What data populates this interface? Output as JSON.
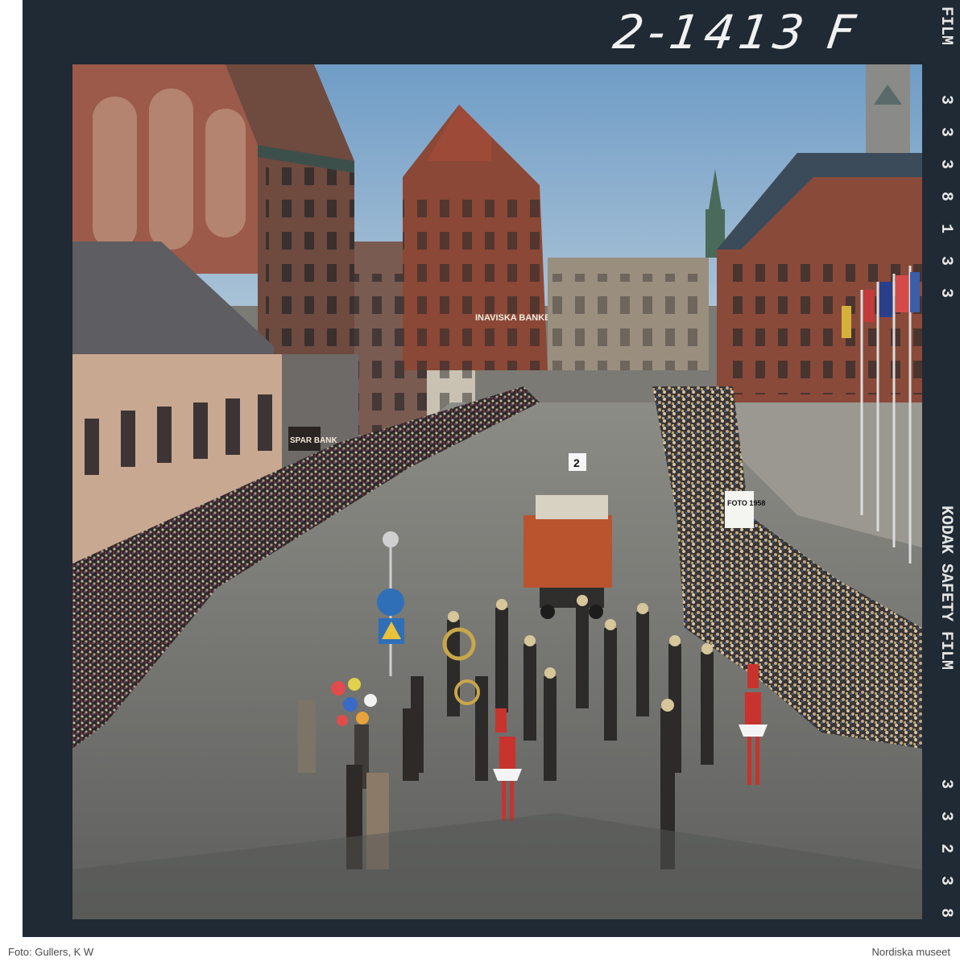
{
  "negative_number": "2-1413 F",
  "film_edge": {
    "top": "FILM",
    "digits": [
      "3",
      "3",
      "3",
      "8",
      "1",
      "3",
      "3"
    ],
    "brand": "KODAK SAFETY FILM",
    "bottom_digits": [
      "3",
      "3",
      "2",
      "3",
      "8"
    ]
  },
  "photo": {
    "signs": {
      "bank": "INAVISKA BANKEN",
      "sparbank": "SPAR BANK",
      "foto": "FOTO 1958",
      "float_number": "2"
    }
  },
  "footer": {
    "credit": "Foto: Gullers, K W",
    "institution": "Nordiska museet"
  },
  "colors": {
    "film_border": "#1f2a34",
    "sky": "#7fa6c9",
    "brick": "#8a4a3a",
    "street": "#7a7a76"
  }
}
